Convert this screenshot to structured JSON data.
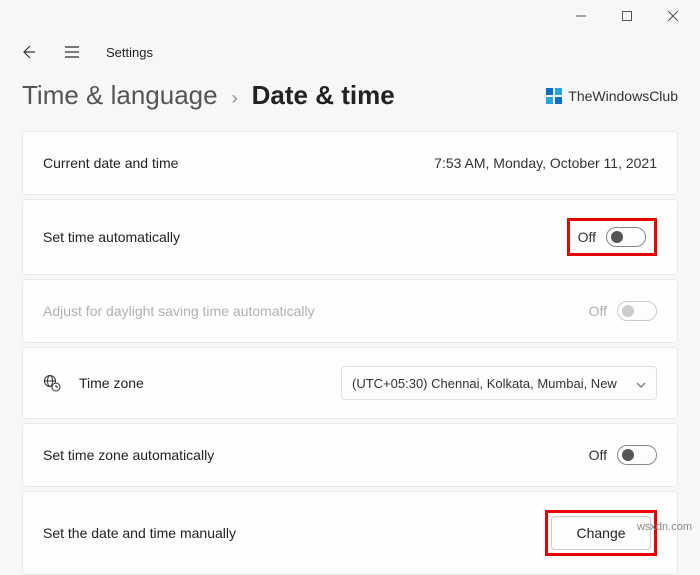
{
  "window": {
    "app_title": "Settings"
  },
  "breadcrumb": {
    "parent": "Time & language",
    "separator": "›",
    "current": "Date & time"
  },
  "brand": {
    "text": "TheWindowsClub"
  },
  "cards": {
    "current": {
      "label": "Current date and time",
      "value": "7:53 AM, Monday, October 11, 2021"
    },
    "auto_time": {
      "label": "Set time automatically",
      "state": "Off"
    },
    "dst": {
      "label": "Adjust for daylight saving time automatically",
      "state": "Off"
    },
    "timezone": {
      "label": "Time zone",
      "selected": "(UTC+05:30) Chennai, Kolkata, Mumbai, New"
    },
    "auto_tz": {
      "label": "Set time zone automatically",
      "state": "Off"
    },
    "manual": {
      "label": "Set the date and time manually",
      "button": "Change"
    }
  },
  "watermark": "wsxdn.com"
}
